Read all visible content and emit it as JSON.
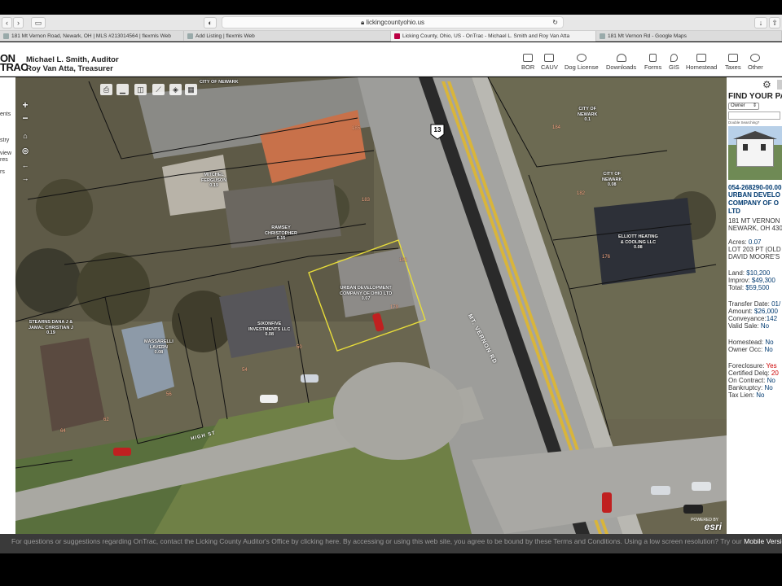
{
  "browser": {
    "url": "lickingcountyohio.us",
    "tabs": [
      {
        "label": "181 Mt Vernon Road, Newark, OH | MLS #213014564 | flexmls Web",
        "active": false
      },
      {
        "label": "Add Listing | flexmls Web",
        "active": false
      },
      {
        "label": "Licking County, Ohio, US - OnTrac - Michael L. Smith and Roy Van Atta",
        "active": true
      },
      {
        "label": "181 Mt Vernon Rd - Google Maps",
        "active": false
      }
    ]
  },
  "header": {
    "logo_line1": "ON",
    "logo_line2": "TRAC",
    "auditor": "Michael L. Smith, Auditor",
    "treasurer": "Roy Van Atta, Treasurer",
    "nav": [
      {
        "label": "BOR",
        "icon": "inbox-icon"
      },
      {
        "label": "CAUV",
        "icon": "tractor-icon"
      },
      {
        "label": "Dog License",
        "icon": "paw-icon"
      },
      {
        "label": "Downloads",
        "icon": "cloud-download-icon"
      },
      {
        "label": "Forms",
        "icon": "document-icon"
      },
      {
        "label": "GIS",
        "icon": "map-pin-icon"
      },
      {
        "label": "Homestead",
        "icon": "house-icon"
      },
      {
        "label": "Taxes",
        "icon": "money-icon"
      },
      {
        "label": "Other",
        "icon": "search-doc-icon"
      }
    ]
  },
  "leftbar": {
    "items": [
      "ents",
      "stry",
      "view",
      "res",
      "rs"
    ]
  },
  "map": {
    "parcels": [
      {
        "name": "CITY OF NEWARK",
        "acres": ""
      },
      {
        "name": "MITCHEL\nFERGUSON",
        "acres": "0.19"
      },
      {
        "name": "RAMSEY\nCHRISTOPHER",
        "acres": "0.15"
      },
      {
        "name": "URBAN DEVELOPMENT\nCOMPANY OF OHIO LTD",
        "acres": "0.07"
      },
      {
        "name": "SIXONFIVE\nINVESTMENTS LLC",
        "acres": "0.08"
      },
      {
        "name": "STEARNS DANA J &\nJAMAL CHRISTIAN J",
        "acres": "0.19"
      },
      {
        "name": "MASSARELLI\nLAVERN",
        "acres": "0.08"
      },
      {
        "name": "CITY OF\nNEWARK",
        "acres": "0.1"
      },
      {
        "name": "CITY OF\nNEWARK",
        "acres": "0.08"
      },
      {
        "name": "ELLIOTT HEATING\n& COOLING LLC",
        "acres": "0.08"
      }
    ],
    "addresses": [
      "185",
      "183",
      "181",
      "179",
      "50",
      "54",
      "56",
      "62",
      "64",
      "184",
      "182",
      "176"
    ],
    "roads": {
      "main": "MT. VERNON RD",
      "side": "HIGH ST",
      "route": "13"
    },
    "attribution": "esri",
    "attribution_small": "POWERED BY"
  },
  "panel": {
    "title": "FIND YOUR PA",
    "search_by": "Owner",
    "dbl_hint": "Double Searching?",
    "parcel_id": "054-268290-00.00",
    "owner_lines": [
      "URBAN DEVELO",
      "COMPANY OF O",
      "LTD"
    ],
    "address_lines": [
      "181 MT VERNON",
      "NEWARK, OH 430"
    ],
    "fields": [
      {
        "label": "Acres:",
        "value": "0.07"
      },
      {
        "label": "LOT 203 PT (OLD",
        "value": ""
      },
      {
        "label": "DAVID MOORE'S",
        "value": ""
      },
      {
        "label": "Land:",
        "value": "$10,200"
      },
      {
        "label": "Improv:",
        "value": "$49,300"
      },
      {
        "label": "Total:",
        "value": "$59,500"
      },
      {
        "label": "Transfer Date:",
        "value": "01/"
      },
      {
        "label": "Amount:",
        "value": "$26,000"
      },
      {
        "label": "Conveyance:",
        "value": "142"
      },
      {
        "label": "Valid Sale:",
        "value": "No"
      },
      {
        "label": "Homestead:",
        "value": "No"
      },
      {
        "label": "Owner Occ:",
        "value": "No"
      },
      {
        "label": "Foreclosure:",
        "value": "Yes"
      },
      {
        "label": "Certified Delq:",
        "value": "20"
      },
      {
        "label": "On Contract:",
        "value": "No"
      },
      {
        "label": "Bankruptcy:",
        "value": "No"
      },
      {
        "label": "Tax Lien:",
        "value": "No"
      }
    ]
  },
  "footer": {
    "text": "For questions or suggestions regarding OnTrac, contact the Licking County Auditor's Office by clicking here. By accessing or using this web site, you agree to be bound by these Terms and Conditions. Using a low screen resolution? Try our",
    "mobile_link": "Mobile Version"
  },
  "colors": {
    "selected_parcel": "#e8dd3a",
    "parcel_line": "#111111",
    "road": "#9a9a9a",
    "road_stripe": "#d9b53a",
    "footer": "#3a3a3a",
    "link": "#003a70",
    "alert": "#cc0000"
  }
}
